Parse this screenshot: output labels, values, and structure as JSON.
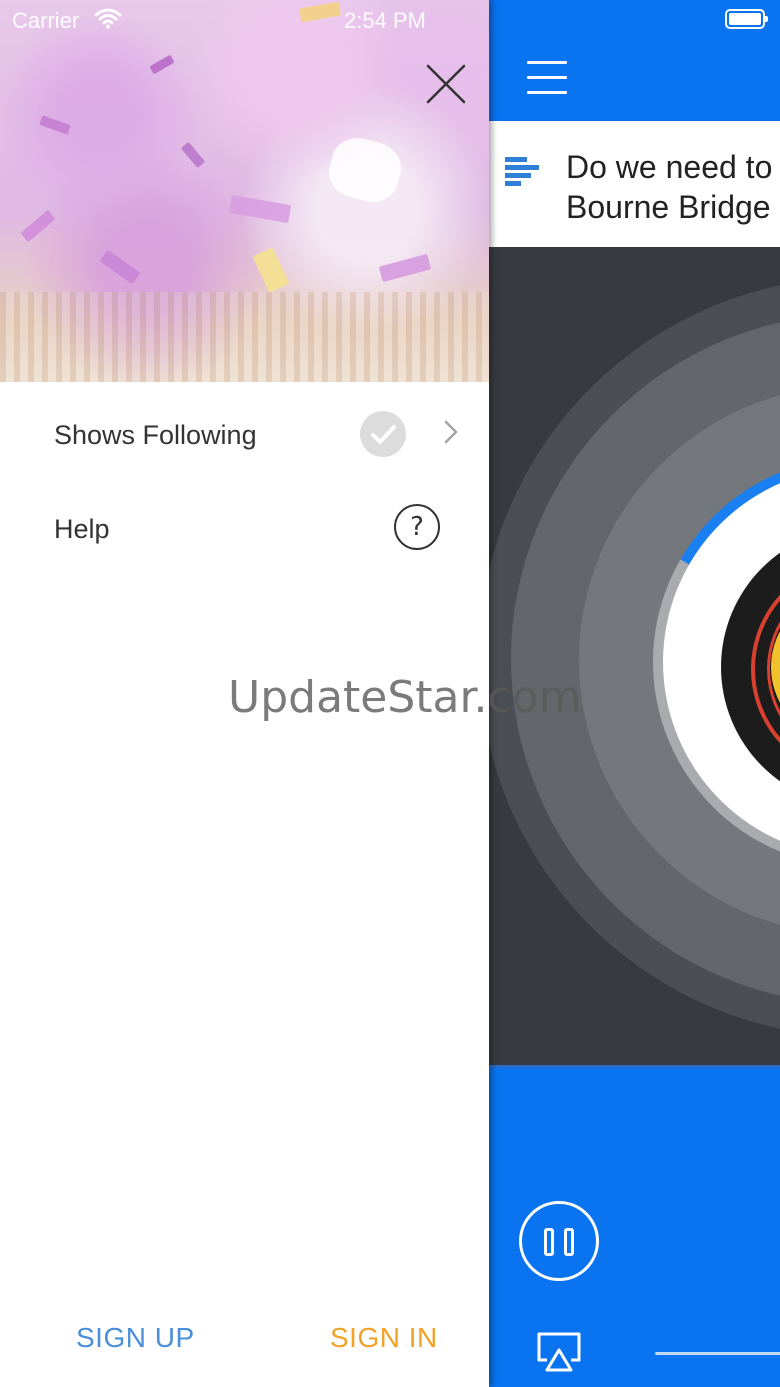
{
  "status_bar": {
    "carrier": "Carrier",
    "time": "2:54 PM"
  },
  "drawer": {
    "menu": [
      {
        "label": "Shows Following",
        "icon": "checkmark-circle-icon",
        "trailing_icon": "chevron-right-icon"
      },
      {
        "label": "Help",
        "icon": "question-circle-icon",
        "icon_glyph": "?"
      }
    ],
    "sign_up_label": "SIGN UP",
    "sign_in_label": "SIGN IN"
  },
  "player": {
    "episode_title": "Do we need to\nBourne Bridge",
    "controls": {
      "pause_icon": "pause-icon",
      "airplay_icon": "airplay-icon"
    }
  },
  "watermark": "UpdateStar.com",
  "colors": {
    "brand_blue": "#0a74f0",
    "sign_up": "#4a8fd8",
    "sign_in": "#f0a326",
    "progress_blue": "#1a7ff0"
  }
}
